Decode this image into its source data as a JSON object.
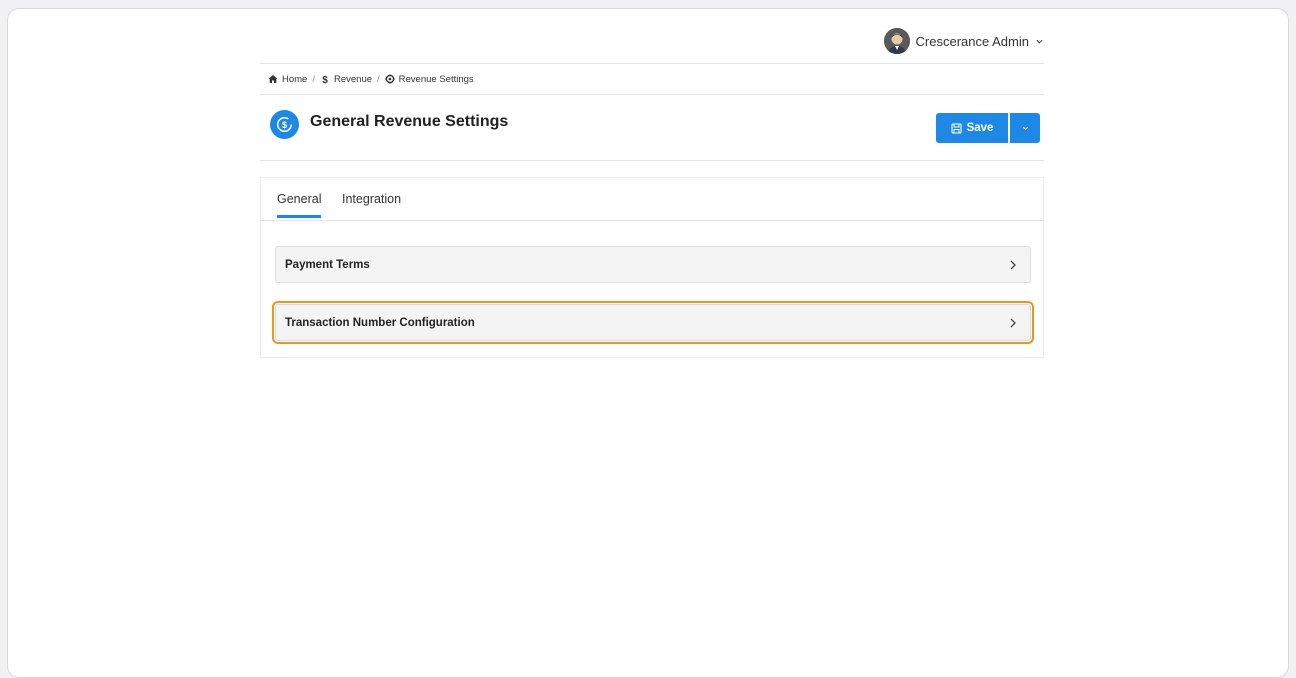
{
  "user": {
    "name": "Crescerance Admin"
  },
  "breadcrumb": {
    "items": [
      {
        "label": "Home",
        "icon": "home-icon"
      },
      {
        "label": "Revenue",
        "icon": "dollar-icon"
      },
      {
        "label": "Revenue Settings",
        "icon": "gear-icon"
      }
    ],
    "separator": "/"
  },
  "header": {
    "title": "General Revenue Settings",
    "icon": "revenue-settings-icon",
    "save_label": "Save"
  },
  "tabs": [
    {
      "label": "General",
      "active": true
    },
    {
      "label": "Integration",
      "active": false
    }
  ],
  "sections": [
    {
      "label": "Payment Terms",
      "highlighted": false
    },
    {
      "label": "Transaction Number Configuration",
      "highlighted": true
    }
  ],
  "colors": {
    "accent": "#1e88e5",
    "highlight": "#f0941e"
  }
}
